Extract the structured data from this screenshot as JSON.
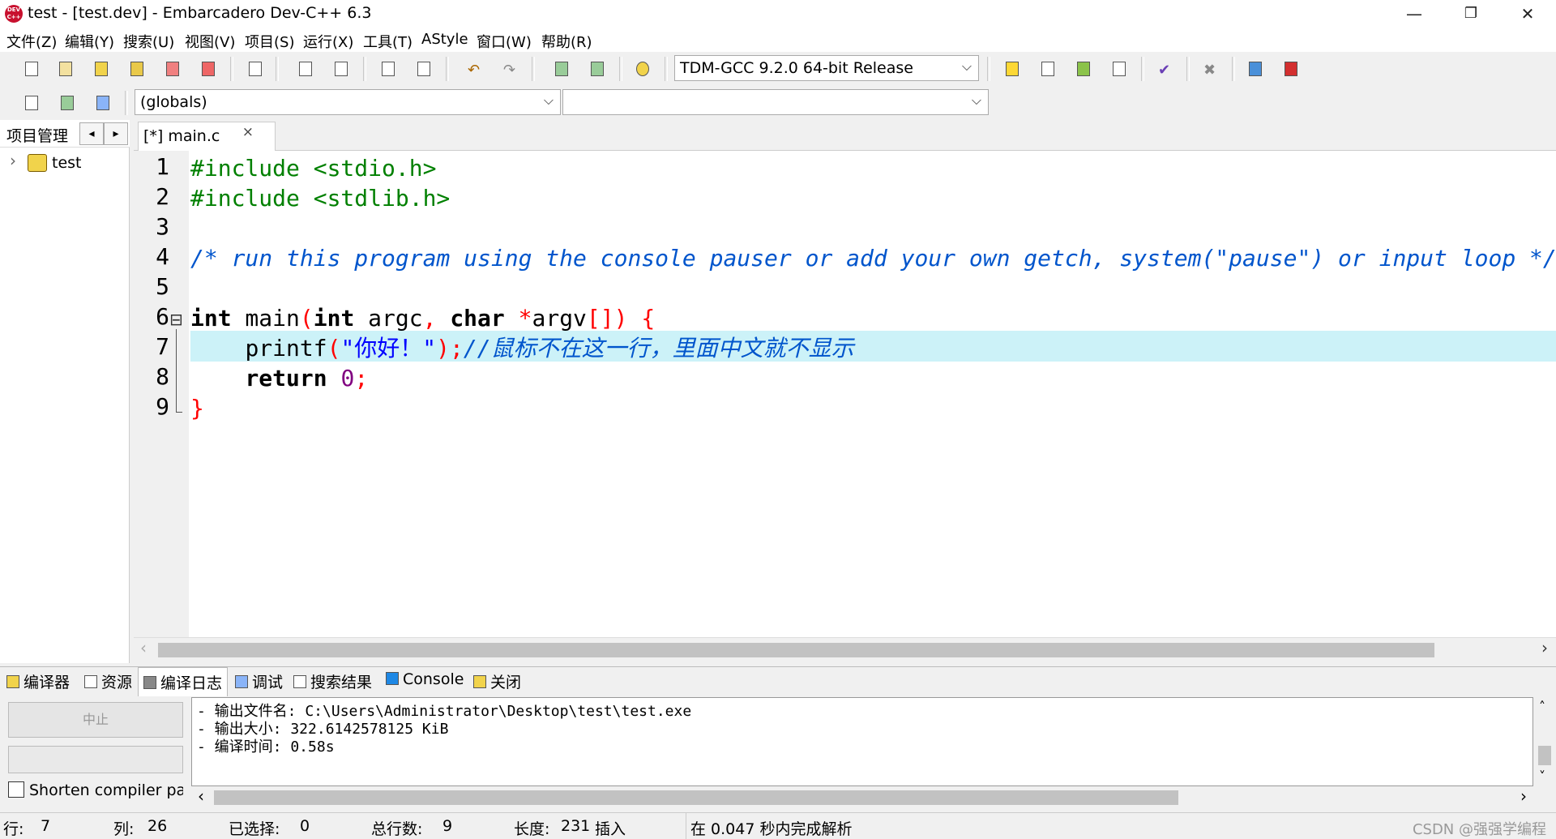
{
  "window": {
    "title": "test - [test.dev] - Embarcadero Dev-C++ 6.3",
    "logo_text": "DEV C++",
    "minimize": "—",
    "restore": "❐",
    "close": "✕"
  },
  "menu": [
    "文件(Z)",
    "编辑(Y)",
    "搜索(U)",
    "视图(V)",
    "项目(S)",
    "运行(X)",
    "工具(T)",
    "AStyle",
    "窗口(W)",
    "帮助(R)"
  ],
  "toolbar": {
    "compiler": "TDM-GCC 9.2.0 64-bit Release",
    "scope": "(globals)",
    "function": ""
  },
  "project_panel": {
    "title": "项目管理",
    "prev": "◂",
    "next": "▸",
    "tree_expander": "›",
    "project_name": "test"
  },
  "editor": {
    "tab_label": "[*] main.c",
    "tab_close": "×",
    "fold_marker": "⊟",
    "line_numbers": [
      "1",
      "2",
      "3",
      "4",
      "5",
      "6",
      "7",
      "8",
      "9"
    ],
    "line1": "#include <stdio.h>",
    "line2": "#include <stdlib.h>",
    "line4": "/* run this program using the console pauser or add your own getch, system(\"pause\") or input loop */",
    "line6": {
      "kw_int": "int",
      "main": " main",
      "paren_open": "(",
      "kw_int2": "int",
      "argc": " argc",
      "comma": ",",
      "kw_char": " char",
      "star": " *",
      "argv": "argv",
      "brackets": "[]",
      "paren_close": ")",
      "brace": " {"
    },
    "line7": {
      "indent": "    ",
      "func": "printf",
      "paren_open": "(",
      "string": "\"你好！\"",
      "paren_close": ")",
      "semi": ";",
      "comment": "//鼠标不在这一行，里面中文就不显示"
    },
    "line8": {
      "indent": "    ",
      "kw_return": "return",
      "zero": " 0",
      "semi": ";"
    },
    "line9": "}",
    "scroll_left": "‹",
    "scroll_right": "›"
  },
  "bottom_tabs": [
    "编译器",
    "资源",
    "编译日志",
    "调试",
    "搜索结果",
    "Console",
    "关闭"
  ],
  "compile_log": {
    "stop_button": "中止",
    "shorten_label": "Shorten compiler paths",
    "lines": [
      "- 输出文件名: C:\\Users\\Administrator\\Desktop\\test\\test.exe",
      "- 输出大小: 322.6142578125 KiB",
      "- 编译时间: 0.58s"
    ],
    "scroll_up": "˄",
    "scroll_down": "˅",
    "scroll_left": "‹",
    "scroll_right": "›"
  },
  "status": {
    "row_label": "行:",
    "row": "7",
    "col_label": "列:",
    "col": "26",
    "sel_label": "已选择:",
    "sel": "0",
    "total_label": "总行数:",
    "total": "9",
    "len_label": "长度:",
    "len": "231",
    "mode": "插入",
    "parse": "在 0.047 秒内完成解析",
    "watermark": "CSDN @强强学编程"
  }
}
